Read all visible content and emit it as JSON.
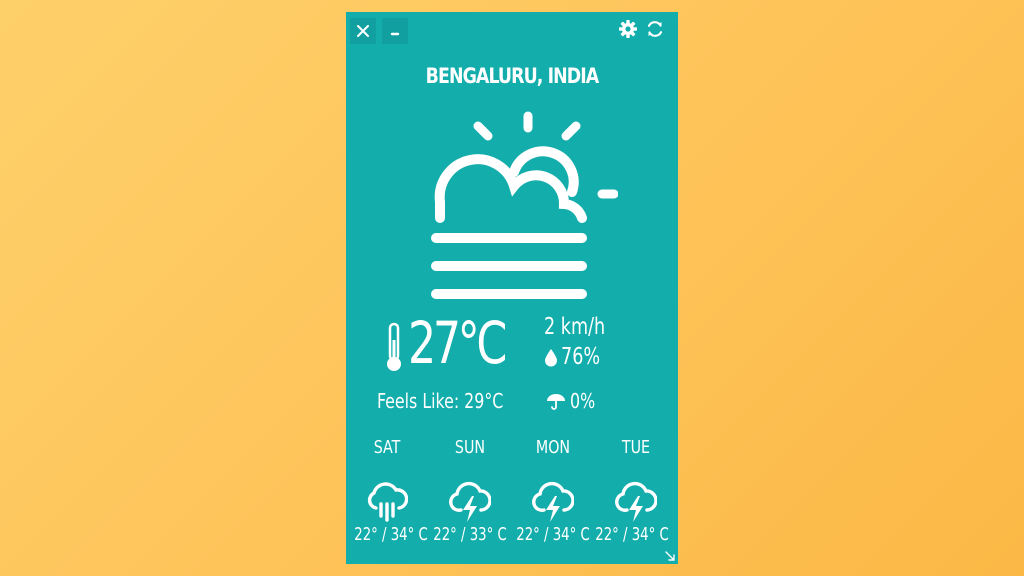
{
  "window": {
    "location": "BENGALURU, INDIA"
  },
  "controls": {
    "close_icon": "close-icon",
    "minimize_icon": "minimize-icon",
    "settings_icon": "gear-icon",
    "refresh_icon": "refresh-icon"
  },
  "current": {
    "condition_icon": "sun-behind-cloud-fog-icon",
    "temperature": "27°C",
    "wind": "2 km/h",
    "humidity": "76%",
    "feels_like": "Feels Like: 29°C",
    "precipitation": "0%"
  },
  "forecast": [
    {
      "day": "SAT",
      "icon": "cloud-rain-icon",
      "temps": "22° / 34° C"
    },
    {
      "day": "SUN",
      "icon": "cloud-lightning-icon",
      "temps": "22° / 33° C"
    },
    {
      "day": "MON",
      "icon": "cloud-lightning-icon",
      "temps": "22° / 34° C"
    },
    {
      "day": "TUE",
      "icon": "cloud-lightning-icon",
      "temps": "22° / 34° C"
    }
  ],
  "colors": {
    "background_gradient_start": "#fed06a",
    "background_gradient_end": "#fbb845",
    "widget_bg": "#13adac",
    "foreground": "#ffffff"
  }
}
